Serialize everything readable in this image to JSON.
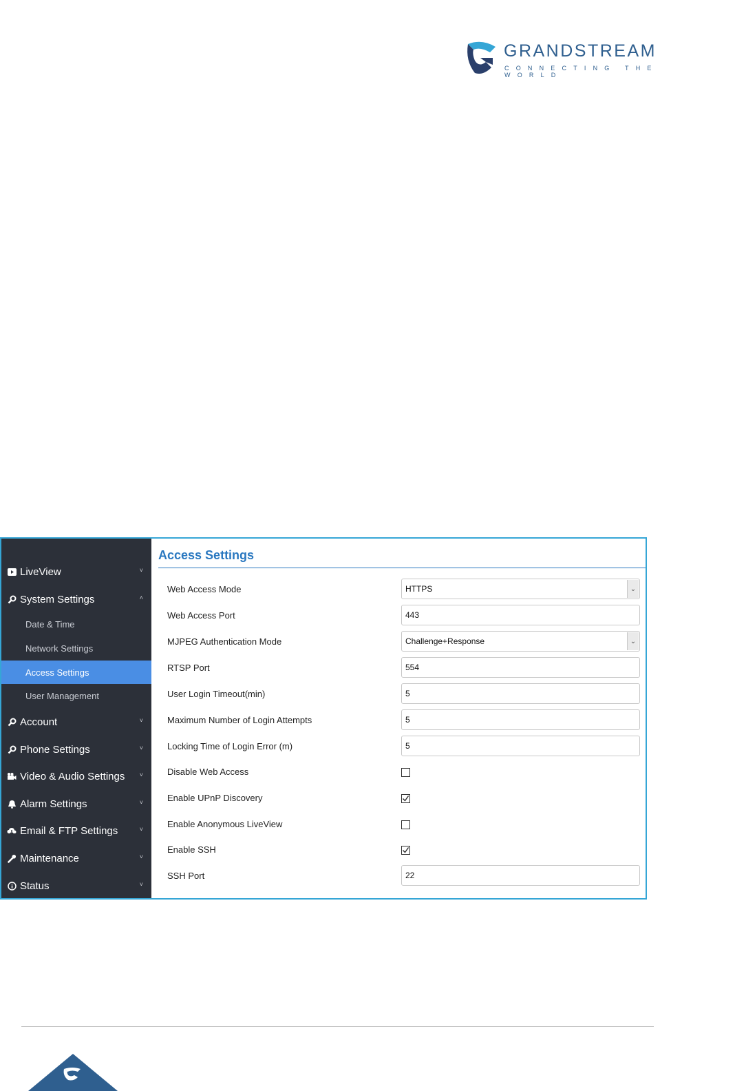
{
  "brand": {
    "name": "GRANDSTREAM",
    "tagline": "CONNECTING THE WORLD",
    "color": "#2f5f8f"
  },
  "sidebar": {
    "items": [
      {
        "label": "LiveView",
        "icon": "play-icon",
        "chevron": "˅"
      },
      {
        "label": "System Settings",
        "icon": "gear-icon",
        "chevron": "˄"
      },
      {
        "label": "Account",
        "icon": "gear-icon",
        "chevron": "˅"
      },
      {
        "label": "Phone Settings",
        "icon": "gear-icon",
        "chevron": "˅"
      },
      {
        "label": "Video & Audio Settings",
        "icon": "camera-icon",
        "chevron": "˅"
      },
      {
        "label": "Alarm Settings",
        "icon": "bell-icon",
        "chevron": "˅"
      },
      {
        "label": "Email & FTP Settings",
        "icon": "cloud-icon",
        "chevron": "˅"
      },
      {
        "label": "Maintenance",
        "icon": "wrench-icon",
        "chevron": "˅"
      },
      {
        "label": "Status",
        "icon": "info-icon",
        "chevron": "˅"
      }
    ],
    "subitems": [
      {
        "label": "Date & Time"
      },
      {
        "label": "Network Settings"
      },
      {
        "label": "Access Settings"
      },
      {
        "label": "User Management"
      }
    ],
    "active_color": "#4a8ee4"
  },
  "main": {
    "title": "Access Settings",
    "fields": {
      "web_access_mode": {
        "label": "Web Access Mode",
        "value": "HTTPS"
      },
      "web_access_port": {
        "label": "Web Access Port",
        "value": "443"
      },
      "mjpeg_auth_mode": {
        "label": "MJPEG Authentication Mode",
        "value": "Challenge+Response"
      },
      "rtsp_port": {
        "label": "RTSP Port",
        "value": "554"
      },
      "login_timeout": {
        "label": "User Login Timeout(min)",
        "value": "5"
      },
      "max_login_attempts": {
        "label": "Maximum Number of Login Attempts",
        "value": "5"
      },
      "locking_time": {
        "label": "Locking Time of Login Error (m)",
        "value": "5"
      },
      "disable_web_access": {
        "label": "Disable Web Access",
        "checked": false
      },
      "enable_upnp": {
        "label": "Enable UPnP Discovery",
        "checked": true
      },
      "enable_anonymous_liveview": {
        "label": "Enable Anonymous LiveView",
        "checked": false
      },
      "enable_ssh": {
        "label": "Enable SSH",
        "checked": true
      },
      "ssh_port": {
        "label": "SSH Port",
        "value": "22"
      }
    }
  }
}
